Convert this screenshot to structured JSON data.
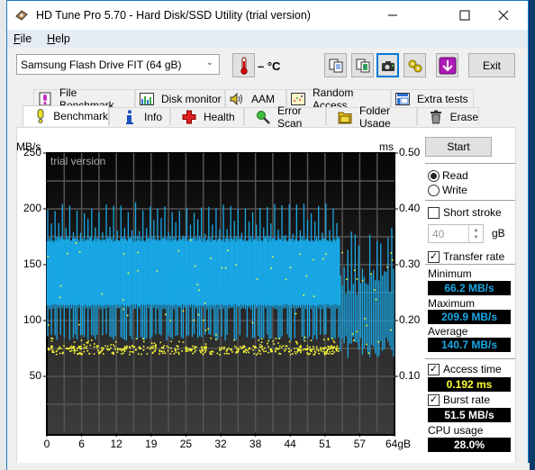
{
  "window": {
    "title": "HD Tune Pro 5.70 - Hard Disk/SSD Utility (trial version)",
    "controls": {
      "minimize": "minimize-icon",
      "maximize": "maximize-icon",
      "close": "close-icon"
    }
  },
  "menu": {
    "items": [
      {
        "label": "File",
        "accel": "F",
        "rest": "ile"
      },
      {
        "label": "Help",
        "accel": "H",
        "rest": "elp"
      }
    ]
  },
  "toolbar": {
    "drive": "Samsung Flash Drive FIT (64 gB)",
    "temperature": "– °C",
    "buttons": [
      "copy-text-icon",
      "copy-image-icon",
      "screenshot-icon",
      "options-icon",
      "save-icon"
    ],
    "exit_label": "Exit"
  },
  "tabs": {
    "top_row": [
      {
        "label": "File Benchmark",
        "icon": "file-benchmark-icon"
      },
      {
        "label": "Disk monitor",
        "icon": "disk-monitor-icon"
      },
      {
        "label": "AAM",
        "icon": "speaker-icon"
      },
      {
        "label": "Random Access",
        "icon": "random-access-icon"
      },
      {
        "label": "Extra tests",
        "icon": "extra-tests-icon"
      }
    ],
    "bottom_row": [
      {
        "label": "Benchmark",
        "icon": "exclamation-icon",
        "active": true
      },
      {
        "label": "Info",
        "icon": "info-icon"
      },
      {
        "label": "Health",
        "icon": "health-cross-icon"
      },
      {
        "label": "Error Scan",
        "icon": "magnifier-icon"
      },
      {
        "label": "Folder Usage",
        "icon": "folder-icon"
      },
      {
        "label": "Erase",
        "icon": "trash-icon"
      }
    ]
  },
  "controls": {
    "start_label": "Start",
    "mode_options": [
      {
        "label": "Read",
        "selected": true
      },
      {
        "label": "Write",
        "selected": false
      }
    ],
    "short_stroke": {
      "label": "Short stroke",
      "checked": false,
      "value": "40",
      "unit": "gB"
    },
    "transfer_rate": {
      "label": "Transfer rate",
      "checked": true
    },
    "minimum": {
      "label": "Minimum",
      "value": "66.2 MB/s"
    },
    "maximum": {
      "label": "Maximum",
      "value": "209.9 MB/s"
    },
    "average": {
      "label": "Average",
      "value": "140.7 MB/s"
    },
    "access_time": {
      "label": "Access time",
      "checked": true,
      "value": "0.192 ms"
    },
    "burst_rate": {
      "label": "Burst rate",
      "checked": true,
      "value": "51.5 MB/s"
    },
    "cpu_usage": {
      "label": "CPU usage",
      "value": "28.0%"
    }
  },
  "colors": {
    "transfer_series": "#19a8e6",
    "access_series": "#ffff33",
    "readout_blue": "#19a8e6",
    "readout_yellow": "#ffff33",
    "readout_white": "#ffffff"
  },
  "chart_data": {
    "type": "line",
    "title": "",
    "watermark": "trial version",
    "ylabel": "MB/s",
    "ylabel_right": "ms",
    "xlabel": "gB",
    "ylim": [
      0,
      250
    ],
    "ylim_right": [
      0,
      0.5
    ],
    "yticks": [
      50,
      100,
      150,
      200,
      250
    ],
    "yticks_right": [
      "0.10",
      "0.20",
      "0.30",
      "0.40",
      "0.50"
    ],
    "xlim": [
      0,
      64
    ],
    "xticks": [
      "0",
      "6",
      "12",
      "19",
      "25",
      "32",
      "38",
      "44",
      "51",
      "57",
      "64gB"
    ],
    "grid": true,
    "series": [
      {
        "name": "Transfer rate (MB/s)",
        "kind": "min-max band per sample",
        "segments": [
          {
            "x_from": 0,
            "x_to": 54,
            "low": 82,
            "high_base": 112,
            "band_top_min": 175,
            "band_top_max": 209.9
          },
          {
            "x_from": 54,
            "x_to": 64,
            "low": 66.2,
            "high_base": 100,
            "band_top_min": 155,
            "band_top_max": 205
          }
        ]
      },
      {
        "name": "Access time (ms)",
        "kind": "scatter",
        "cluster_center_ms": 0.148,
        "cluster_spread_ms": 0.01,
        "outlier_range_ms": [
          0.14,
          0.35
        ],
        "x_extent": [
          0,
          54
        ]
      }
    ]
  }
}
